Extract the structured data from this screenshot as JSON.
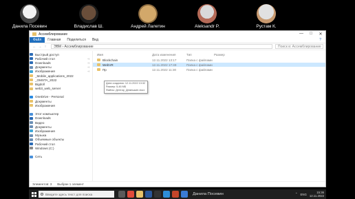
{
  "participants": [
    {
      "name": "Данила Посевин"
    },
    {
      "name": "Владислав Ш."
    },
    {
      "name": "Андрей Лалетин"
    },
    {
      "name": "Aleksandr P."
    },
    {
      "name": "Рустам К."
    }
  ],
  "explorer": {
    "title": "Ассемблирование",
    "window_controls": [
      "—",
      "□",
      "✕"
    ],
    "ribbon_tabs": [
      "Файл",
      "Главная",
      "Поделиться",
      "Вид"
    ],
    "help_icon": "?",
    "breadcrumb": [
      "ЭВМ",
      "Ассемблирование"
    ],
    "search_placeholder": "Поиск в: Ассемблирование",
    "nav_items": [
      {
        "label": "Быстрый доступ",
        "color": "#2b6bb5"
      },
      {
        "label": "Рабочий стол",
        "color": "#2b6bb5",
        "pin": "📌"
      },
      {
        "label": "Downloads",
        "color": "#2b6bb5",
        "pin": "📌"
      },
      {
        "label": "Документы",
        "color": "#6b8fb5",
        "pin": "📌"
      },
      {
        "label": "Изображения",
        "color": "#3fa8d8",
        "pin": "📌"
      },
      {
        "label": "_Mobile_applications_2022",
        "color": "#e8c26a"
      },
      {
        "label": "_OMSTA_2022",
        "color": "#e8c26a"
      },
      {
        "label": "Bigdoll",
        "color": "#e8c26a"
      },
      {
        "label": "web3_web_server",
        "color": "#e8c26a"
      },
      {
        "label": "",
        "color": "#ffffff"
      },
      {
        "label": "OneDrive - Personal",
        "color": "#2b8ae0"
      },
      {
        "label": "Документы",
        "color": "#e8c26a"
      },
      {
        "label": "Изображения",
        "color": "#e8c26a"
      },
      {
        "label": "",
        "color": "#ffffff"
      },
      {
        "label": "Этот компьютер",
        "color": "#4a90d9"
      },
      {
        "label": "Downloads",
        "color": "#2b6bb5"
      },
      {
        "label": "Видео",
        "color": "#6b8fb5"
      },
      {
        "label": "Документы",
        "color": "#6b8fb5"
      },
      {
        "label": "Изображения",
        "color": "#3fa8d8"
      },
      {
        "label": "Музыка",
        "color": "#6b8fb5"
      },
      {
        "label": "Объемные объекты",
        "color": "#6b8fb5"
      },
      {
        "label": "Рабочий стол",
        "color": "#2b6bb5"
      },
      {
        "label": "Windows (C:)",
        "color": "#8a8a8a"
      },
      {
        "label": "",
        "color": "#ffffff"
      },
      {
        "label": "Сеть",
        "color": "#4a90d9"
      }
    ],
    "columns": [
      "Имя",
      "Дата изменения",
      "Тип",
      "Размер"
    ],
    "files": [
      {
        "name": "Blockchain",
        "date": "12.11.2022 13:17",
        "type": "Папка с файлами",
        "size": "",
        "selected": false
      },
      {
        "name": "WebVR",
        "date": "12.11.2022 17:49",
        "type": "Папка с файлами",
        "size": "",
        "selected": true
      },
      {
        "name": "Пр",
        "date": "12.11.2022 11:30",
        "type": "Папка с файлами",
        "size": "",
        "selected": false
      }
    ],
    "tooltip": [
      "Дата создания: 12.11.2022 13:32",
      "Размер: 5,46 МБ",
      "Файлы: Дептар_Демешкин.docx"
    ],
    "status": {
      "items": "Элементов: 3",
      "selected": "Выбран 1 элемент"
    }
  },
  "taskbar": {
    "search_placeholder": "Введите здесь текст для поиска",
    "meeting_label": "Данила Посевин",
    "lang": "ENG",
    "time": "15:36",
    "date": "12.11.2022",
    "apps": [
      {
        "icon": "task-view-icon",
        "color": "#5a5a5a"
      },
      {
        "icon": "chrome-icon",
        "color": "#e04b3a"
      },
      {
        "icon": "explorer-icon",
        "color": "#e8c26a"
      },
      {
        "icon": "word-icon",
        "color": "#2b579a"
      },
      {
        "icon": "terminal-icon",
        "color": "#333333"
      },
      {
        "icon": "vscode-icon",
        "color": "#2d8ed8"
      },
      {
        "icon": "powerpoint-icon",
        "color": "#c4452a"
      },
      {
        "icon": "camera-icon",
        "color": "#3a7bd5"
      }
    ]
  }
}
